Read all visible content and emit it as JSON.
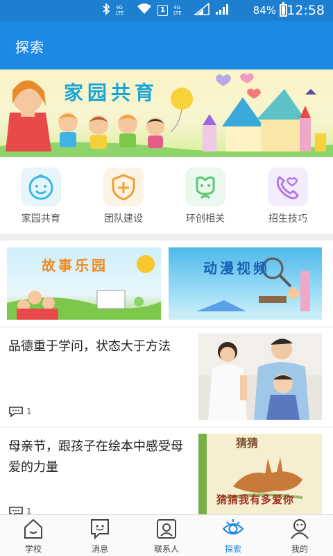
{
  "status_bar": {
    "network_label_1": "4G LTE",
    "sim_label": "1",
    "network_label_2": "4G LTE",
    "battery": "84%",
    "time": "12:58"
  },
  "app_bar": {
    "title": "探索"
  },
  "banner": {
    "title": "家园共育"
  },
  "quick_links": [
    {
      "label": "家园共育",
      "icon": "baby-face-icon",
      "color": "#37b9ea",
      "bg": "#e8f6fc"
    },
    {
      "label": "团队建设",
      "icon": "shield-plus-icon",
      "color": "#f0a030",
      "bg": "#fdf3e4"
    },
    {
      "label": "环创相关",
      "icon": "flower-face-icon",
      "color": "#5cc77a",
      "bg": "#eaf8ee"
    },
    {
      "label": "招生技巧",
      "icon": "phone-heart-icon",
      "color": "#b07be0",
      "bg": "#f4ecfc"
    }
  ],
  "tiles": [
    {
      "title": "故事乐园"
    },
    {
      "title": "动漫视频"
    }
  ],
  "articles": [
    {
      "title": "品德重于学问，状态大于方法",
      "comments": "1",
      "thumb": "parent-child-photo"
    },
    {
      "title": "母亲节，跟孩子在绘本中感受母爱的力量",
      "comments": "1",
      "thumb_text": "猜猜我有多爱你",
      "thumb_top": "猜猜"
    }
  ],
  "tab_bar": [
    {
      "label": "学校",
      "icon": "house-icon",
      "active": false
    },
    {
      "label": "消息",
      "icon": "message-icon",
      "active": false
    },
    {
      "label": "联系人",
      "icon": "contacts-icon",
      "active": false
    },
    {
      "label": "探索",
      "icon": "eye-icon",
      "active": true
    },
    {
      "label": "我的",
      "icon": "profile-icon",
      "active": false
    }
  ],
  "colors": {
    "primary": "#1e88e5",
    "status_bar": "#1e7fd0"
  }
}
